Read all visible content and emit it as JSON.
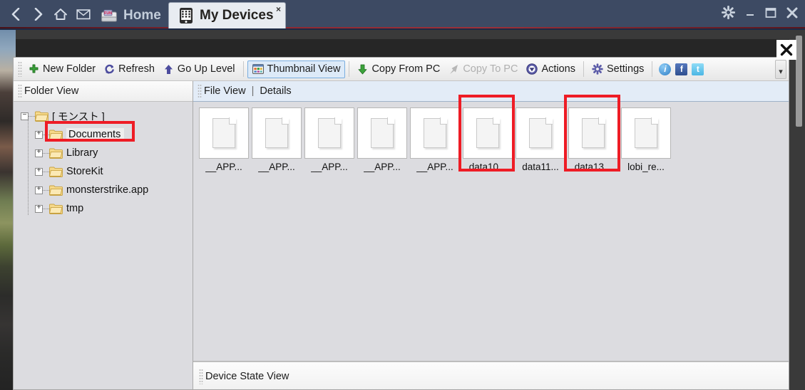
{
  "browser": {
    "nav": [
      {
        "name": "back",
        "glyph": "‹"
      },
      {
        "name": "forward",
        "glyph": "›"
      },
      {
        "name": "home",
        "glyph": "⌂"
      },
      {
        "name": "mail",
        "glyph": "✉"
      }
    ],
    "tabs": [
      {
        "label": "Home",
        "icon": "disk-icon",
        "badge": "FUN",
        "active": false
      },
      {
        "label": "My Devices",
        "icon": "device-icon",
        "active": true,
        "close_glyph": "×"
      }
    ],
    "window_controls": [
      {
        "name": "settings-gear",
        "glyph": "⚙"
      },
      {
        "name": "minimize",
        "glyph": "–"
      },
      {
        "name": "maximize",
        "glyph": "❐"
      },
      {
        "name": "close",
        "glyph": "✕"
      }
    ],
    "overlay_close_glyph": "✕",
    "titlebar_color": "#3d4a63",
    "accent_red": "#8c2730"
  },
  "toolbar": {
    "items": [
      {
        "label": "New Folder",
        "icon": "plus-icon",
        "state": "normal"
      },
      {
        "label": "Refresh",
        "icon": "refresh-icon",
        "state": "normal"
      },
      {
        "label": "Go Up Level",
        "icon": "arrow-up-icon",
        "state": "normal"
      },
      {
        "label": "Thumbnail View",
        "icon": "thumbnail-icon",
        "state": "active"
      },
      {
        "label": "Copy From PC",
        "icon": "download-icon",
        "state": "normal"
      },
      {
        "label": "Copy To PC",
        "icon": "upload-icon",
        "state": "disabled"
      },
      {
        "label": "Actions",
        "icon": "actions-icon",
        "state": "normal"
      },
      {
        "label": "Settings",
        "icon": "gear-icon",
        "state": "normal"
      }
    ],
    "social": [
      {
        "name": "info-icon",
        "glyph": "i",
        "color": "#3f8fd8"
      },
      {
        "name": "facebook-icon",
        "glyph": "f",
        "color": "#3a5b9b"
      },
      {
        "name": "twitter-icon",
        "glyph": "t",
        "color": "#5fc4ef"
      }
    ],
    "overflow_glyph": "▾"
  },
  "left_pane": {
    "header": "Folder View",
    "tree": {
      "root": {
        "label": "[ モンスト ]",
        "expander": "−"
      },
      "children": [
        {
          "label": "Documents",
          "expander": "+",
          "selected": true,
          "highlighted": true
        },
        {
          "label": "Library",
          "expander": "+",
          "selected": false,
          "highlighted": false
        },
        {
          "label": "StoreKit",
          "expander": "+",
          "selected": false,
          "highlighted": false
        },
        {
          "label": "monsterstrike.app",
          "expander": "+",
          "selected": false,
          "highlighted": false
        },
        {
          "label": "tmp",
          "expander": "+",
          "selected": false,
          "highlighted": false
        }
      ]
    }
  },
  "right_pane": {
    "header": {
      "file_view": "File View",
      "separator": "|",
      "details": "Details"
    },
    "files": [
      {
        "label": "__APP...",
        "highlighted": false
      },
      {
        "label": "__APP...",
        "highlighted": false
      },
      {
        "label": "__APP...",
        "highlighted": false
      },
      {
        "label": "__APP...",
        "highlighted": false
      },
      {
        "label": "__APP...",
        "highlighted": false
      },
      {
        "label": "data10...",
        "highlighted": true
      },
      {
        "label": "data11...",
        "highlighted": false
      },
      {
        "label": "data13...",
        "highlighted": true
      },
      {
        "label": "lobi_re...",
        "highlighted": false
      }
    ],
    "state_view": "Device State View"
  },
  "highlight_color": "#ee1c25"
}
